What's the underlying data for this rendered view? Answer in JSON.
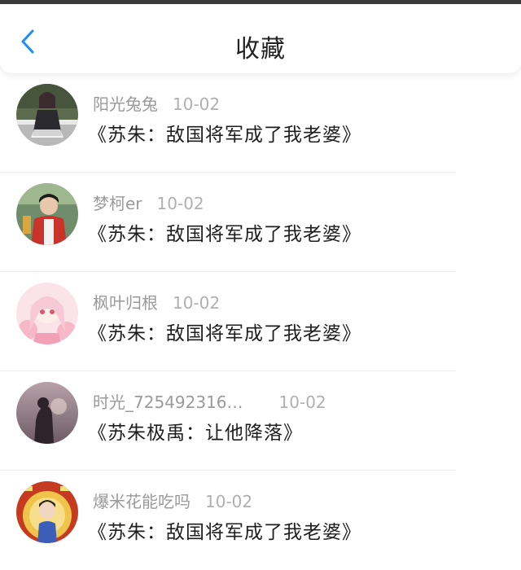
{
  "header": {
    "title": "收藏",
    "back_icon": "chevron-left-icon",
    "accent_color": "#1a8cff"
  },
  "items": [
    {
      "user": "阳光兔兔",
      "date": "10-02",
      "title": "《苏朱：敌国将军成了我老婆》"
    },
    {
      "user": "梦柯er",
      "date": "10-02",
      "title": "《苏朱：敌国将军成了我老婆》"
    },
    {
      "user": "枫叶归根",
      "date": "10-02",
      "title": "《苏朱：敌国将军成了我老婆》"
    },
    {
      "user": "时光_725492316…",
      "date": "10-02",
      "title": "《苏朱极禹：让他降落》"
    },
    {
      "user": "爆米花能吃吗",
      "date": "10-02",
      "title": "《苏朱：敌国将军成了我老婆》"
    }
  ]
}
